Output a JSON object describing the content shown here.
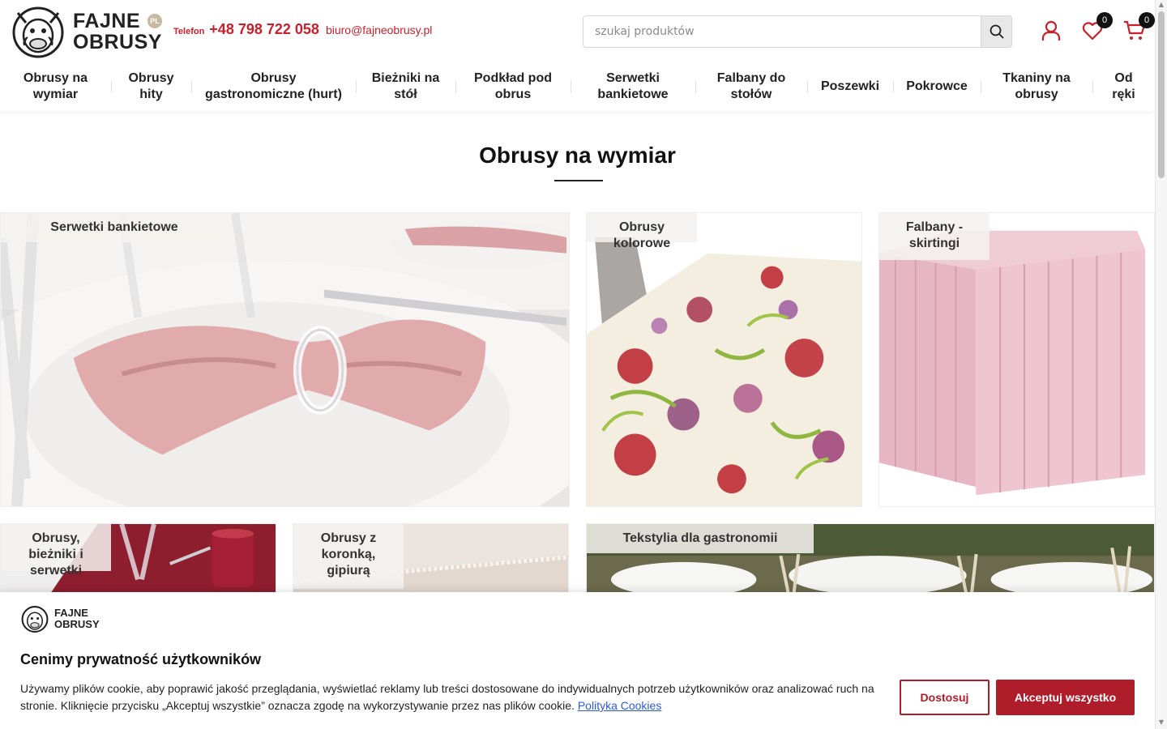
{
  "header": {
    "logo_line1": "FAJNE",
    "logo_line2": "OBRUSY",
    "logo_badge": "PL",
    "phone_label": "Telefon",
    "phone": "+48 798 722 058",
    "email": "biuro@fajneobrusy.pl",
    "search_placeholder": "szukaj produktów",
    "wishlist_count": "0",
    "cart_count": "0"
  },
  "nav": {
    "items": [
      {
        "label": "Obrusy na wymiar"
      },
      {
        "label": "Obrusy hity"
      },
      {
        "label": "Obrusy gastronomiczne (hurt)"
      },
      {
        "label": "Bieżniki na stół"
      },
      {
        "label": "Podkład pod obrus"
      },
      {
        "label": "Serwetki bankietowe"
      },
      {
        "label": "Falbany do stołów"
      },
      {
        "label": "Poszewki"
      },
      {
        "label": "Pokrowce"
      },
      {
        "label": "Tkaniny na obrusy"
      },
      {
        "label": "Od ręki"
      }
    ]
  },
  "page": {
    "title": "Obrusy na wymiar"
  },
  "tiles": [
    {
      "label": "Serwetki bankietowe"
    },
    {
      "label": "Obrusy kolorowe"
    },
    {
      "label": "Falbany - skirtingi"
    },
    {
      "label": "Obrusy, bieżniki i serwetki"
    },
    {
      "label": "Obrusy z koronką, gipiurą"
    },
    {
      "label": "Tekstylia dla gastronomii"
    }
  ],
  "cookie": {
    "logo_line1": "FAJNE",
    "logo_line2": "OBRUSY",
    "title": "Cenimy prywatność użytkowników",
    "text": "Używamy plików cookie, aby poprawić jakość przeglądania, wyświetlać reklamy lub treści dostosowane do indywidualnych potrzeb użytkowników oraz analizować ruch na stronie. Kliknięcie przycisku „Akceptuj wszystkie” oznacza zgodę na wykorzystywanie przez nas plików cookie.",
    "policy_link": "Polityka Cookies",
    "customize_button": "Dostosuj",
    "accept_button": "Akceptuj wszystko"
  },
  "colors": {
    "brand_red": "#b01d2a",
    "contact_red": "#c9202c",
    "text_dark": "#1a1a1a"
  },
  "icons": {
    "search": "search-icon",
    "account": "user-icon",
    "wishlist": "heart-icon",
    "cart": "cart-icon"
  }
}
